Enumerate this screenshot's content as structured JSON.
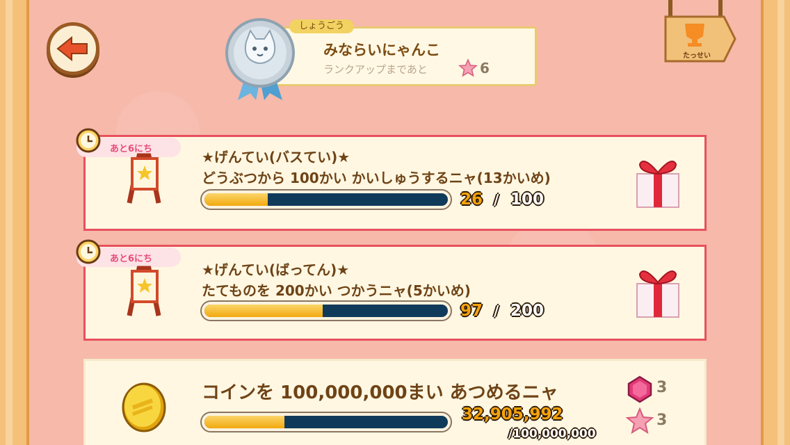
{
  "header": {
    "rank_tag": "しょうごう",
    "title_name": "みならいにゃんこ",
    "rank_up_label": "ランクアップまであと",
    "rank_up_count": "6",
    "achievements_label": "たっせい"
  },
  "missions": [
    {
      "deadline": "あと6にち",
      "title": "★げんてい(バスてい)★",
      "description": "どうぶつから 100かい かいしゅうするニャ(13かいめ)",
      "progress_current": "26",
      "progress_slash": "/",
      "progress_max": "100",
      "progress_fraction": 0.26,
      "reward_icon": "gift-box-icon"
    },
    {
      "deadline": "あと6にち",
      "title": "★げんてい(ばってん)★",
      "description": "たてものを 200かい つかうニャ(5かいめ)",
      "progress_current": "97",
      "progress_slash": "/",
      "progress_max": "200",
      "progress_fraction": 0.485,
      "reward_icon": "gift-box-icon"
    },
    {
      "description": "コインを 100,000,000まい あつめるニャ",
      "progress_current": "32,905,992",
      "progress_max": "/100,000,000",
      "progress_fraction": 0.329,
      "rewards": [
        {
          "icon": "pink-gem-icon",
          "count": "3"
        },
        {
          "icon": "pink-star-icon",
          "count": "3"
        }
      ]
    }
  ],
  "colors": {
    "background": "#f6b9aa",
    "card": "#fff7e2",
    "card_border": "#e8505e",
    "progress_fill": "#f2a90f",
    "progress_track": "#103a5a",
    "text_brown": "#6e4316"
  }
}
